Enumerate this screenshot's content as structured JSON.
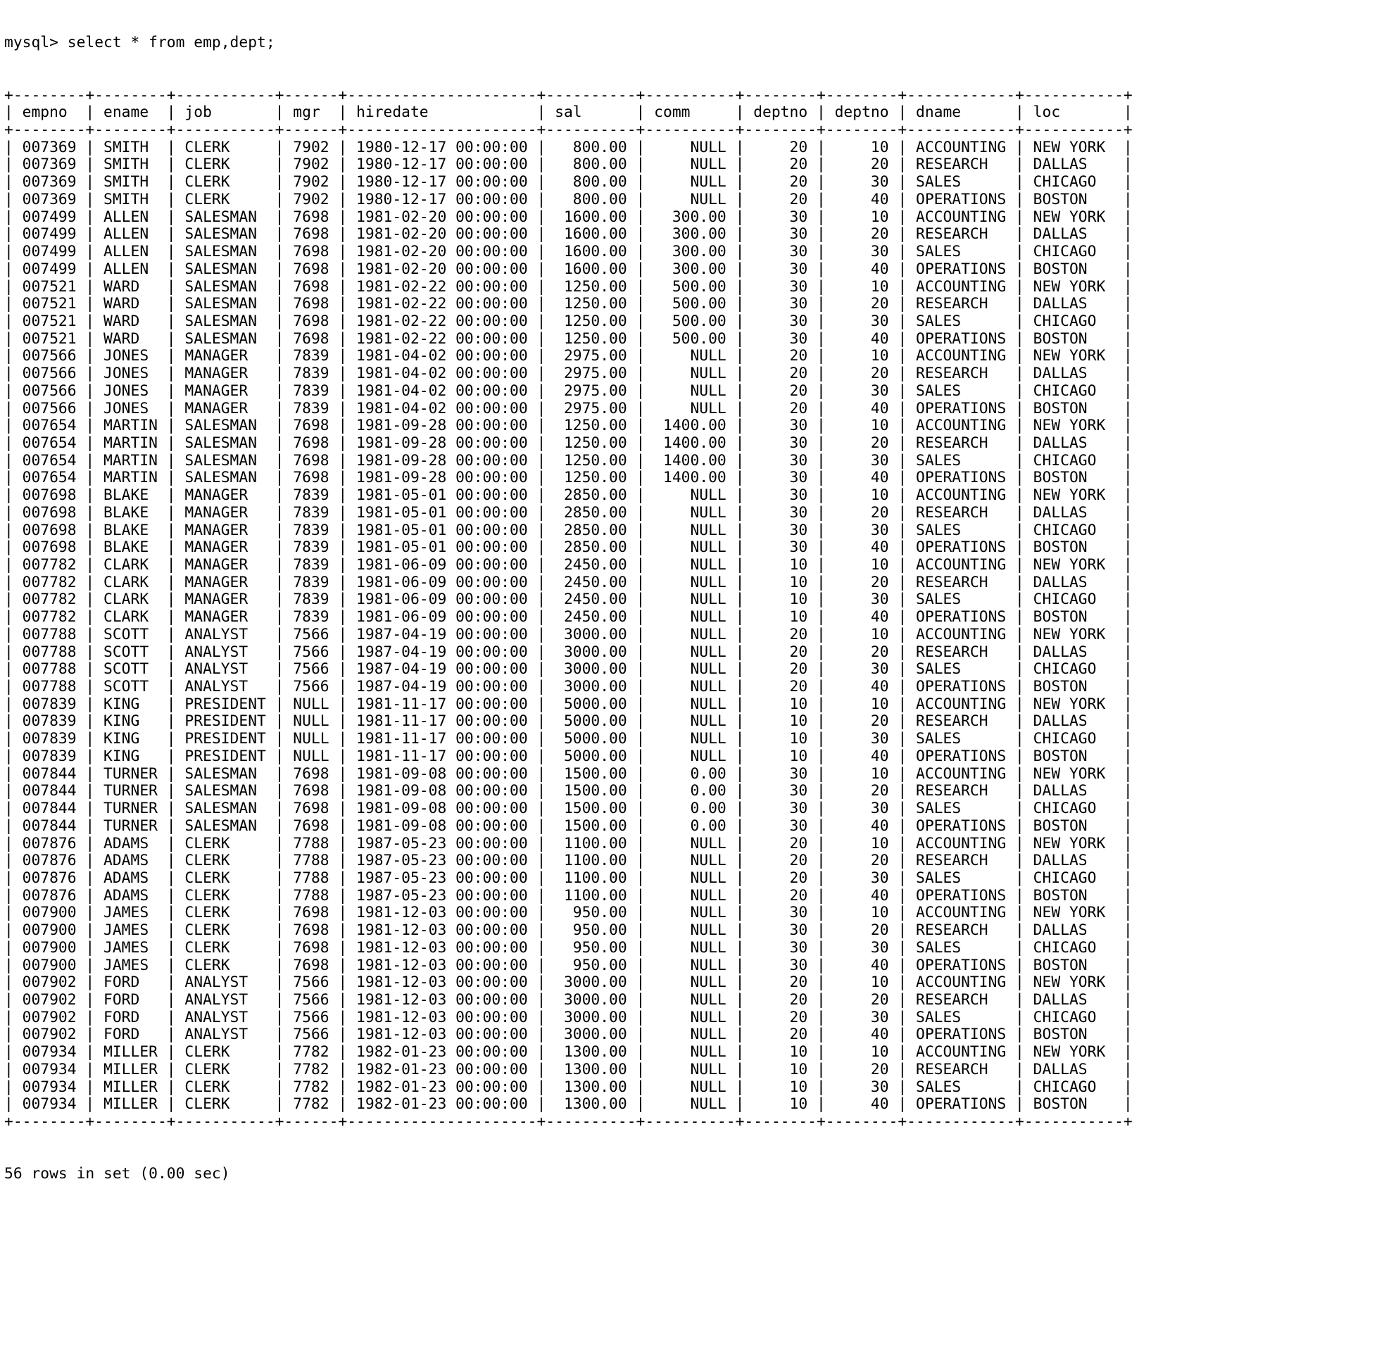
{
  "terminal": {
    "prompt": "mysql>",
    "command": " select * from emp,dept;",
    "prompt_line": "mysql> select * from emp,dept;",
    "footer": "56 rows in set (0.00 sec)",
    "row_count": 56,
    "elapsed": "0.00 sec",
    "colors": {
      "background": "#ffffff",
      "foreground": "#000000"
    }
  },
  "table": {
    "columns": [
      {
        "name": "empno",
        "width": 8,
        "align": "right"
      },
      {
        "name": "ename",
        "width": 8,
        "align": "left"
      },
      {
        "name": "job",
        "width": 11,
        "align": "left"
      },
      {
        "name": "mgr",
        "width": 6,
        "align": "right"
      },
      {
        "name": "hiredate",
        "width": 21,
        "align": "left"
      },
      {
        "name": "sal",
        "width": 10,
        "align": "right"
      },
      {
        "name": "comm",
        "width": 10,
        "align": "right"
      },
      {
        "name": "deptno",
        "width": 8,
        "align": "right"
      },
      {
        "name": "deptno",
        "width": 8,
        "align": "right"
      },
      {
        "name": "dname",
        "width": 12,
        "align": "left"
      },
      {
        "name": "loc",
        "width": 11,
        "align": "left"
      }
    ],
    "headers": [
      "empno",
      "ename",
      "job",
      "mgr",
      "hiredate",
      "sal",
      "comm",
      "deptno",
      "deptno",
      "dname",
      "loc"
    ],
    "rows": [
      [
        "007369",
        "SMITH",
        "CLERK",
        "7902",
        "1980-12-17 00:00:00",
        "800.00",
        "NULL",
        "20",
        "10",
        "ACCOUNTING",
        "NEW YORK"
      ],
      [
        "007369",
        "SMITH",
        "CLERK",
        "7902",
        "1980-12-17 00:00:00",
        "800.00",
        "NULL",
        "20",
        "20",
        "RESEARCH",
        "DALLAS"
      ],
      [
        "007369",
        "SMITH",
        "CLERK",
        "7902",
        "1980-12-17 00:00:00",
        "800.00",
        "NULL",
        "20",
        "30",
        "SALES",
        "CHICAGO"
      ],
      [
        "007369",
        "SMITH",
        "CLERK",
        "7902",
        "1980-12-17 00:00:00",
        "800.00",
        "NULL",
        "20",
        "40",
        "OPERATIONS",
        "BOSTON"
      ],
      [
        "007499",
        "ALLEN",
        "SALESMAN",
        "7698",
        "1981-02-20 00:00:00",
        "1600.00",
        "300.00",
        "30",
        "10",
        "ACCOUNTING",
        "NEW YORK"
      ],
      [
        "007499",
        "ALLEN",
        "SALESMAN",
        "7698",
        "1981-02-20 00:00:00",
        "1600.00",
        "300.00",
        "30",
        "20",
        "RESEARCH",
        "DALLAS"
      ],
      [
        "007499",
        "ALLEN",
        "SALESMAN",
        "7698",
        "1981-02-20 00:00:00",
        "1600.00",
        "300.00",
        "30",
        "30",
        "SALES",
        "CHICAGO"
      ],
      [
        "007499",
        "ALLEN",
        "SALESMAN",
        "7698",
        "1981-02-20 00:00:00",
        "1600.00",
        "300.00",
        "30",
        "40",
        "OPERATIONS",
        "BOSTON"
      ],
      [
        "007521",
        "WARD",
        "SALESMAN",
        "7698",
        "1981-02-22 00:00:00",
        "1250.00",
        "500.00",
        "30",
        "10",
        "ACCOUNTING",
        "NEW YORK"
      ],
      [
        "007521",
        "WARD",
        "SALESMAN",
        "7698",
        "1981-02-22 00:00:00",
        "1250.00",
        "500.00",
        "30",
        "20",
        "RESEARCH",
        "DALLAS"
      ],
      [
        "007521",
        "WARD",
        "SALESMAN",
        "7698",
        "1981-02-22 00:00:00",
        "1250.00",
        "500.00",
        "30",
        "30",
        "SALES",
        "CHICAGO"
      ],
      [
        "007521",
        "WARD",
        "SALESMAN",
        "7698",
        "1981-02-22 00:00:00",
        "1250.00",
        "500.00",
        "30",
        "40",
        "OPERATIONS",
        "BOSTON"
      ],
      [
        "007566",
        "JONES",
        "MANAGER",
        "7839",
        "1981-04-02 00:00:00",
        "2975.00",
        "NULL",
        "20",
        "10",
        "ACCOUNTING",
        "NEW YORK"
      ],
      [
        "007566",
        "JONES",
        "MANAGER",
        "7839",
        "1981-04-02 00:00:00",
        "2975.00",
        "NULL",
        "20",
        "20",
        "RESEARCH",
        "DALLAS"
      ],
      [
        "007566",
        "JONES",
        "MANAGER",
        "7839",
        "1981-04-02 00:00:00",
        "2975.00",
        "NULL",
        "20",
        "30",
        "SALES",
        "CHICAGO"
      ],
      [
        "007566",
        "JONES",
        "MANAGER",
        "7839",
        "1981-04-02 00:00:00",
        "2975.00",
        "NULL",
        "20",
        "40",
        "OPERATIONS",
        "BOSTON"
      ],
      [
        "007654",
        "MARTIN",
        "SALESMAN",
        "7698",
        "1981-09-28 00:00:00",
        "1250.00",
        "1400.00",
        "30",
        "10",
        "ACCOUNTING",
        "NEW YORK"
      ],
      [
        "007654",
        "MARTIN",
        "SALESMAN",
        "7698",
        "1981-09-28 00:00:00",
        "1250.00",
        "1400.00",
        "30",
        "20",
        "RESEARCH",
        "DALLAS"
      ],
      [
        "007654",
        "MARTIN",
        "SALESMAN",
        "7698",
        "1981-09-28 00:00:00",
        "1250.00",
        "1400.00",
        "30",
        "30",
        "SALES",
        "CHICAGO"
      ],
      [
        "007654",
        "MARTIN",
        "SALESMAN",
        "7698",
        "1981-09-28 00:00:00",
        "1250.00",
        "1400.00",
        "30",
        "40",
        "OPERATIONS",
        "BOSTON"
      ],
      [
        "007698",
        "BLAKE",
        "MANAGER",
        "7839",
        "1981-05-01 00:00:00",
        "2850.00",
        "NULL",
        "30",
        "10",
        "ACCOUNTING",
        "NEW YORK"
      ],
      [
        "007698",
        "BLAKE",
        "MANAGER",
        "7839",
        "1981-05-01 00:00:00",
        "2850.00",
        "NULL",
        "30",
        "20",
        "RESEARCH",
        "DALLAS"
      ],
      [
        "007698",
        "BLAKE",
        "MANAGER",
        "7839",
        "1981-05-01 00:00:00",
        "2850.00",
        "NULL",
        "30",
        "30",
        "SALES",
        "CHICAGO"
      ],
      [
        "007698",
        "BLAKE",
        "MANAGER",
        "7839",
        "1981-05-01 00:00:00",
        "2850.00",
        "NULL",
        "30",
        "40",
        "OPERATIONS",
        "BOSTON"
      ],
      [
        "007782",
        "CLARK",
        "MANAGER",
        "7839",
        "1981-06-09 00:00:00",
        "2450.00",
        "NULL",
        "10",
        "10",
        "ACCOUNTING",
        "NEW YORK"
      ],
      [
        "007782",
        "CLARK",
        "MANAGER",
        "7839",
        "1981-06-09 00:00:00",
        "2450.00",
        "NULL",
        "10",
        "20",
        "RESEARCH",
        "DALLAS"
      ],
      [
        "007782",
        "CLARK",
        "MANAGER",
        "7839",
        "1981-06-09 00:00:00",
        "2450.00",
        "NULL",
        "10",
        "30",
        "SALES",
        "CHICAGO"
      ],
      [
        "007782",
        "CLARK",
        "MANAGER",
        "7839",
        "1981-06-09 00:00:00",
        "2450.00",
        "NULL",
        "10",
        "40",
        "OPERATIONS",
        "BOSTON"
      ],
      [
        "007788",
        "SCOTT",
        "ANALYST",
        "7566",
        "1987-04-19 00:00:00",
        "3000.00",
        "NULL",
        "20",
        "10",
        "ACCOUNTING",
        "NEW YORK"
      ],
      [
        "007788",
        "SCOTT",
        "ANALYST",
        "7566",
        "1987-04-19 00:00:00",
        "3000.00",
        "NULL",
        "20",
        "20",
        "RESEARCH",
        "DALLAS"
      ],
      [
        "007788",
        "SCOTT",
        "ANALYST",
        "7566",
        "1987-04-19 00:00:00",
        "3000.00",
        "NULL",
        "20",
        "30",
        "SALES",
        "CHICAGO"
      ],
      [
        "007788",
        "SCOTT",
        "ANALYST",
        "7566",
        "1987-04-19 00:00:00",
        "3000.00",
        "NULL",
        "20",
        "40",
        "OPERATIONS",
        "BOSTON"
      ],
      [
        "007839",
        "KING",
        "PRESIDENT",
        "NULL",
        "1981-11-17 00:00:00",
        "5000.00",
        "NULL",
        "10",
        "10",
        "ACCOUNTING",
        "NEW YORK"
      ],
      [
        "007839",
        "KING",
        "PRESIDENT",
        "NULL",
        "1981-11-17 00:00:00",
        "5000.00",
        "NULL",
        "10",
        "20",
        "RESEARCH",
        "DALLAS"
      ],
      [
        "007839",
        "KING",
        "PRESIDENT",
        "NULL",
        "1981-11-17 00:00:00",
        "5000.00",
        "NULL",
        "10",
        "30",
        "SALES",
        "CHICAGO"
      ],
      [
        "007839",
        "KING",
        "PRESIDENT",
        "NULL",
        "1981-11-17 00:00:00",
        "5000.00",
        "NULL",
        "10",
        "40",
        "OPERATIONS",
        "BOSTON"
      ],
      [
        "007844",
        "TURNER",
        "SALESMAN",
        "7698",
        "1981-09-08 00:00:00",
        "1500.00",
        "0.00",
        "30",
        "10",
        "ACCOUNTING",
        "NEW YORK"
      ],
      [
        "007844",
        "TURNER",
        "SALESMAN",
        "7698",
        "1981-09-08 00:00:00",
        "1500.00",
        "0.00",
        "30",
        "20",
        "RESEARCH",
        "DALLAS"
      ],
      [
        "007844",
        "TURNER",
        "SALESMAN",
        "7698",
        "1981-09-08 00:00:00",
        "1500.00",
        "0.00",
        "30",
        "30",
        "SALES",
        "CHICAGO"
      ],
      [
        "007844",
        "TURNER",
        "SALESMAN",
        "7698",
        "1981-09-08 00:00:00",
        "1500.00",
        "0.00",
        "30",
        "40",
        "OPERATIONS",
        "BOSTON"
      ],
      [
        "007876",
        "ADAMS",
        "CLERK",
        "7788",
        "1987-05-23 00:00:00",
        "1100.00",
        "NULL",
        "20",
        "10",
        "ACCOUNTING",
        "NEW YORK"
      ],
      [
        "007876",
        "ADAMS",
        "CLERK",
        "7788",
        "1987-05-23 00:00:00",
        "1100.00",
        "NULL",
        "20",
        "20",
        "RESEARCH",
        "DALLAS"
      ],
      [
        "007876",
        "ADAMS",
        "CLERK",
        "7788",
        "1987-05-23 00:00:00",
        "1100.00",
        "NULL",
        "20",
        "30",
        "SALES",
        "CHICAGO"
      ],
      [
        "007876",
        "ADAMS",
        "CLERK",
        "7788",
        "1987-05-23 00:00:00",
        "1100.00",
        "NULL",
        "20",
        "40",
        "OPERATIONS",
        "BOSTON"
      ],
      [
        "007900",
        "JAMES",
        "CLERK",
        "7698",
        "1981-12-03 00:00:00",
        "950.00",
        "NULL",
        "30",
        "10",
        "ACCOUNTING",
        "NEW YORK"
      ],
      [
        "007900",
        "JAMES",
        "CLERK",
        "7698",
        "1981-12-03 00:00:00",
        "950.00",
        "NULL",
        "30",
        "20",
        "RESEARCH",
        "DALLAS"
      ],
      [
        "007900",
        "JAMES",
        "CLERK",
        "7698",
        "1981-12-03 00:00:00",
        "950.00",
        "NULL",
        "30",
        "30",
        "SALES",
        "CHICAGO"
      ],
      [
        "007900",
        "JAMES",
        "CLERK",
        "7698",
        "1981-12-03 00:00:00",
        "950.00",
        "NULL",
        "30",
        "40",
        "OPERATIONS",
        "BOSTON"
      ],
      [
        "007902",
        "FORD",
        "ANALYST",
        "7566",
        "1981-12-03 00:00:00",
        "3000.00",
        "NULL",
        "20",
        "10",
        "ACCOUNTING",
        "NEW YORK"
      ],
      [
        "007902",
        "FORD",
        "ANALYST",
        "7566",
        "1981-12-03 00:00:00",
        "3000.00",
        "NULL",
        "20",
        "20",
        "RESEARCH",
        "DALLAS"
      ],
      [
        "007902",
        "FORD",
        "ANALYST",
        "7566",
        "1981-12-03 00:00:00",
        "3000.00",
        "NULL",
        "20",
        "30",
        "SALES",
        "CHICAGO"
      ],
      [
        "007902",
        "FORD",
        "ANALYST",
        "7566",
        "1981-12-03 00:00:00",
        "3000.00",
        "NULL",
        "20",
        "40",
        "OPERATIONS",
        "BOSTON"
      ],
      [
        "007934",
        "MILLER",
        "CLERK",
        "7782",
        "1982-01-23 00:00:00",
        "1300.00",
        "NULL",
        "10",
        "10",
        "ACCOUNTING",
        "NEW YORK"
      ],
      [
        "007934",
        "MILLER",
        "CLERK",
        "7782",
        "1982-01-23 00:00:00",
        "1300.00",
        "NULL",
        "10",
        "20",
        "RESEARCH",
        "DALLAS"
      ],
      [
        "007934",
        "MILLER",
        "CLERK",
        "7782",
        "1982-01-23 00:00:00",
        "1300.00",
        "NULL",
        "10",
        "30",
        "SALES",
        "CHICAGO"
      ],
      [
        "007934",
        "MILLER",
        "CLERK",
        "7782",
        "1982-01-23 00:00:00",
        "1300.00",
        "NULL",
        "10",
        "40",
        "OPERATIONS",
        "BOSTON"
      ]
    ]
  }
}
